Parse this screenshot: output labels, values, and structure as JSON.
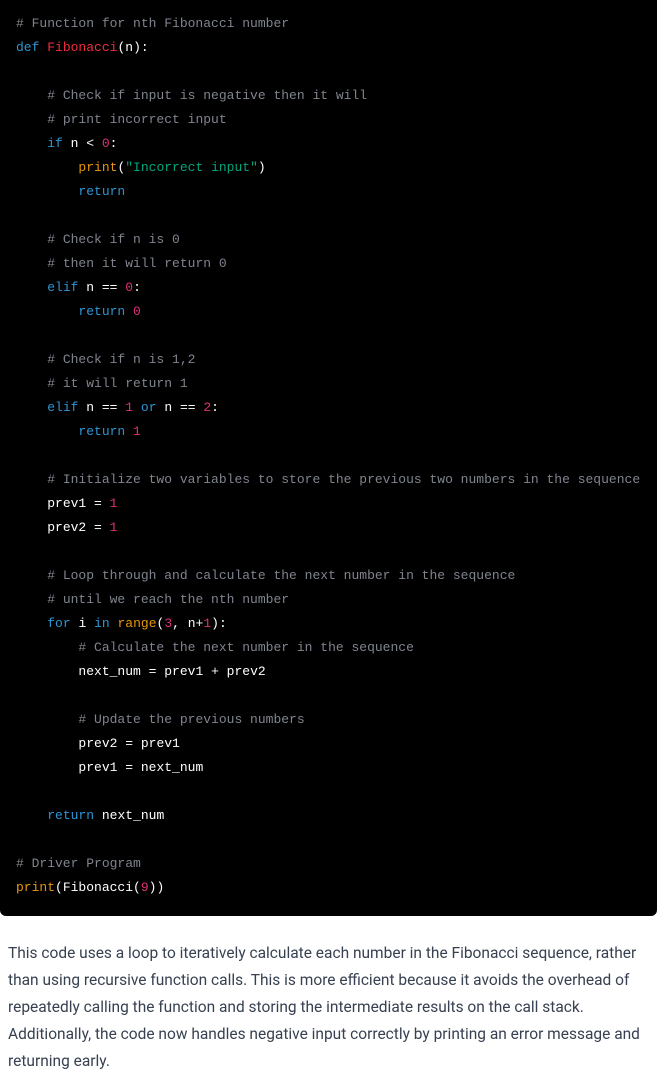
{
  "code": {
    "c01": "# Function for nth Fibonacci number",
    "kw_def": "def",
    "fn_name": "Fibonacci",
    "lp": "(",
    "param_n": "n",
    "rp_colon": "):",
    "c02a": "# Check if input is negative then it will",
    "c02b": "# print incorrect input",
    "kw_if": "if",
    "sp": " ",
    "id_n": "n",
    "op_lt": " < ",
    "num0": "0",
    "colon": ":",
    "bi_print": "print",
    "str_incorrect": "\"Incorrect input\"",
    "rp": ")",
    "kw_return": "return",
    "c03a": "# Check if n is 0",
    "c03b": "# then it will return 0",
    "kw_elif": "elif",
    "op_eq": " == ",
    "c04a": "# Check if n is 1,2",
    "c04b": "# it will return 1",
    "num1": "1",
    "kw_or": "or",
    "num2": "2",
    "c05": "# Initialize two variables to store the previous two numbers in the sequence",
    "id_prev1": "prev1",
    "op_assign": " = ",
    "id_prev2": "prev2",
    "c06a": "# Loop through and calculate the next number in the sequence",
    "c06b": "# until we reach the nth number",
    "kw_for": "for",
    "id_i": "i",
    "kw_in": "in",
    "bi_range": "range",
    "num3": "3",
    "comma": ", ",
    "op_plus": "+",
    "c07": "# Calculate the next number in the sequence",
    "id_next": "next_num",
    "op_plus_sp": " + ",
    "c08": "# Update the previous numbers",
    "c09": "# Driver Program",
    "num9": "9",
    "rp2": "))"
  },
  "explanation": "This code uses a loop to iteratively calculate each number in the Fibonacci sequence, rather than using recursive function calls. This is more efficient because it avoids the overhead of repeatedly calling the function and storing the intermediate results on the call stack. Additionally, the code now handles negative input correctly by printing an error message and returning early."
}
